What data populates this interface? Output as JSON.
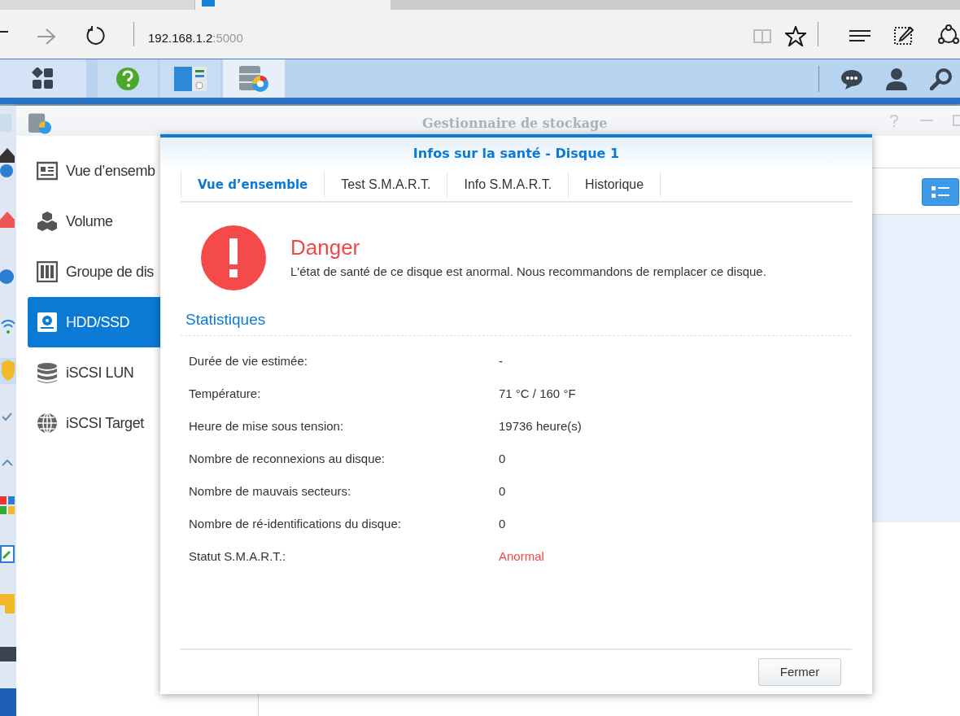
{
  "browser": {
    "tabs": [
      {
        "selected": false
      },
      {
        "selected": true
      }
    ],
    "address": {
      "host": "192.168.1.2",
      "port": ":5000"
    }
  },
  "app_window": {
    "title": "Gestionnaire de stockage",
    "sidebar": {
      "items": [
        {
          "label": "Vue d’ensemb",
          "selected": false
        },
        {
          "label": "Volume",
          "selected": false
        },
        {
          "label": "Groupe de dis",
          "selected": false
        },
        {
          "label": "HDD/SSD",
          "selected": true
        },
        {
          "label": "iSCSI LUN",
          "selected": false
        },
        {
          "label": "iSCSI Target",
          "selected": false
        }
      ]
    }
  },
  "dialog": {
    "title": "Infos sur la santé - Disque 1",
    "tabs": [
      {
        "label": "Vue d’ensemble",
        "selected": true
      },
      {
        "label": "Test S.M.A.R.T.",
        "selected": false
      },
      {
        "label": "Info S.M.A.R.T.",
        "selected": false
      },
      {
        "label": "Historique",
        "selected": false
      }
    ],
    "status": {
      "title": "Danger",
      "message": "L'état de santé de ce disque est anormal. Nous recommandons de remplacer ce disque."
    },
    "section": "Statistiques",
    "stats": [
      {
        "label": "Durée de vie estimée:",
        "value": "-",
        "alert": false
      },
      {
        "label": "Température:",
        "value": "71 °C / 160 °F",
        "alert": false
      },
      {
        "label": "Heure de mise sous tension:",
        "value": "19736 heure(s)",
        "alert": false
      },
      {
        "label": "Nombre de reconnexions au disque:",
        "value": "0",
        "alert": false
      },
      {
        "label": "Nombre de mauvais secteurs:",
        "value": "0",
        "alert": false
      },
      {
        "label": "Nombre de ré-identifications du disque:",
        "value": "0",
        "alert": false
      },
      {
        "label": "Statut S.M.A.R.T.:",
        "value": "Anormal",
        "alert": true
      }
    ],
    "close_button": "Fermer"
  }
}
